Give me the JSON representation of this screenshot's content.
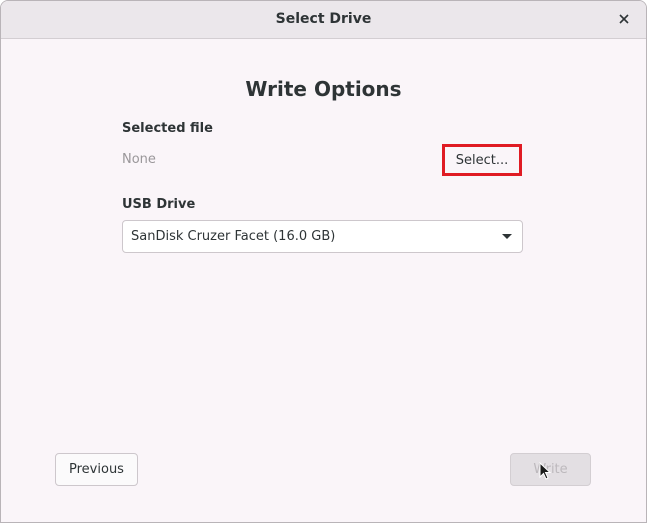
{
  "window": {
    "title": "Select Drive"
  },
  "main": {
    "heading": "Write Options",
    "selected_file_label": "Selected file",
    "selected_file_value": "None",
    "select_button_label": "Select...",
    "usb_drive_label": "USB Drive",
    "usb_drive_selected": "SanDisk Cruzer Facet (16.0 GB)"
  },
  "footer": {
    "previous_label": "Previous",
    "write_label": "Write"
  },
  "colors": {
    "highlight_box": "#e01b24",
    "window_background": "#faf5f9",
    "titlebar_background": "#ebe7eb"
  },
  "icons": {
    "close": "close-icon",
    "dropdown": "chevron-down-icon",
    "cursor": "mouse-pointer-icon"
  }
}
